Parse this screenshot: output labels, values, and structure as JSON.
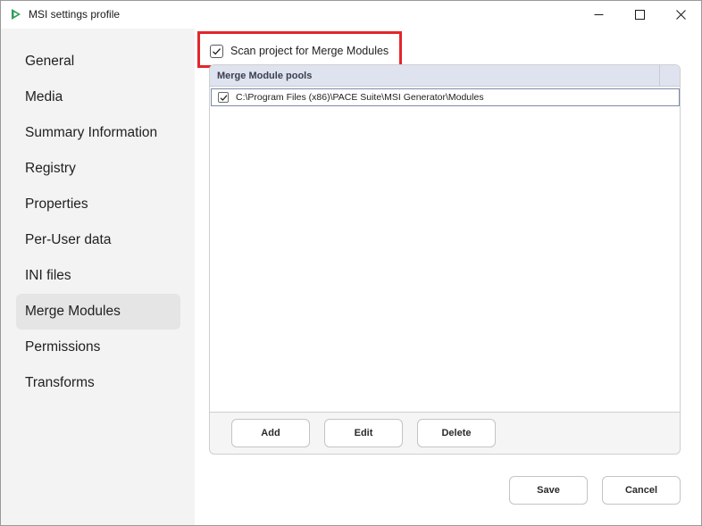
{
  "window": {
    "title": "MSI settings profile",
    "accent_color": "#2e9e57"
  },
  "sidebar": {
    "items": [
      {
        "label": "General"
      },
      {
        "label": "Media"
      },
      {
        "label": "Summary Information"
      },
      {
        "label": "Registry"
      },
      {
        "label": "Properties"
      },
      {
        "label": "Per-User data"
      },
      {
        "label": "INI files"
      },
      {
        "label": "Merge Modules",
        "active": true
      },
      {
        "label": "Permissions"
      },
      {
        "label": "Transforms"
      }
    ]
  },
  "main": {
    "scan_checkbox": {
      "label": "Scan project for Merge Modules",
      "checked": true
    },
    "highlight_color": "#e3262b",
    "pools": {
      "header": "Merge Module pools",
      "rows": [
        {
          "path": "C:\\Program Files (x86)\\PACE Suite\\MSI Generator\\Modules",
          "checked": true
        }
      ],
      "buttons": {
        "add": "Add",
        "edit": "Edit",
        "delete": "Delete"
      }
    }
  },
  "footer": {
    "save": "Save",
    "cancel": "Cancel"
  }
}
